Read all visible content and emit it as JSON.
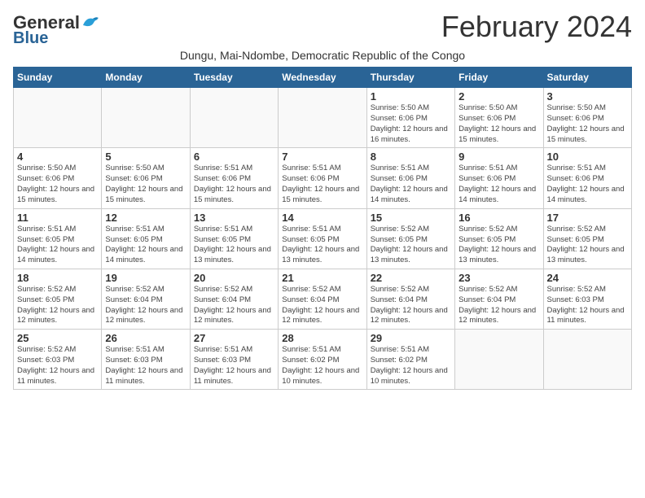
{
  "logo": {
    "general": "General",
    "blue": "Blue"
  },
  "title": "February 2024",
  "subtitle": "Dungu, Mai-Ndombe, Democratic Republic of the Congo",
  "headers": [
    "Sunday",
    "Monday",
    "Tuesday",
    "Wednesday",
    "Thursday",
    "Friday",
    "Saturday"
  ],
  "weeks": [
    [
      {
        "num": "",
        "info": ""
      },
      {
        "num": "",
        "info": ""
      },
      {
        "num": "",
        "info": ""
      },
      {
        "num": "",
        "info": ""
      },
      {
        "num": "1",
        "info": "Sunrise: 5:50 AM\nSunset: 6:06 PM\nDaylight: 12 hours\nand 16 minutes."
      },
      {
        "num": "2",
        "info": "Sunrise: 5:50 AM\nSunset: 6:06 PM\nDaylight: 12 hours\nand 15 minutes."
      },
      {
        "num": "3",
        "info": "Sunrise: 5:50 AM\nSunset: 6:06 PM\nDaylight: 12 hours\nand 15 minutes."
      }
    ],
    [
      {
        "num": "4",
        "info": "Sunrise: 5:50 AM\nSunset: 6:06 PM\nDaylight: 12 hours\nand 15 minutes."
      },
      {
        "num": "5",
        "info": "Sunrise: 5:50 AM\nSunset: 6:06 PM\nDaylight: 12 hours\nand 15 minutes."
      },
      {
        "num": "6",
        "info": "Sunrise: 5:51 AM\nSunset: 6:06 PM\nDaylight: 12 hours\nand 15 minutes."
      },
      {
        "num": "7",
        "info": "Sunrise: 5:51 AM\nSunset: 6:06 PM\nDaylight: 12 hours\nand 15 minutes."
      },
      {
        "num": "8",
        "info": "Sunrise: 5:51 AM\nSunset: 6:06 PM\nDaylight: 12 hours\nand 14 minutes."
      },
      {
        "num": "9",
        "info": "Sunrise: 5:51 AM\nSunset: 6:06 PM\nDaylight: 12 hours\nand 14 minutes."
      },
      {
        "num": "10",
        "info": "Sunrise: 5:51 AM\nSunset: 6:06 PM\nDaylight: 12 hours\nand 14 minutes."
      }
    ],
    [
      {
        "num": "11",
        "info": "Sunrise: 5:51 AM\nSunset: 6:05 PM\nDaylight: 12 hours\nand 14 minutes."
      },
      {
        "num": "12",
        "info": "Sunrise: 5:51 AM\nSunset: 6:05 PM\nDaylight: 12 hours\nand 14 minutes."
      },
      {
        "num": "13",
        "info": "Sunrise: 5:51 AM\nSunset: 6:05 PM\nDaylight: 12 hours\nand 13 minutes."
      },
      {
        "num": "14",
        "info": "Sunrise: 5:51 AM\nSunset: 6:05 PM\nDaylight: 12 hours\nand 13 minutes."
      },
      {
        "num": "15",
        "info": "Sunrise: 5:52 AM\nSunset: 6:05 PM\nDaylight: 12 hours\nand 13 minutes."
      },
      {
        "num": "16",
        "info": "Sunrise: 5:52 AM\nSunset: 6:05 PM\nDaylight: 12 hours\nand 13 minutes."
      },
      {
        "num": "17",
        "info": "Sunrise: 5:52 AM\nSunset: 6:05 PM\nDaylight: 12 hours\nand 13 minutes."
      }
    ],
    [
      {
        "num": "18",
        "info": "Sunrise: 5:52 AM\nSunset: 6:05 PM\nDaylight: 12 hours\nand 12 minutes."
      },
      {
        "num": "19",
        "info": "Sunrise: 5:52 AM\nSunset: 6:04 PM\nDaylight: 12 hours\nand 12 minutes."
      },
      {
        "num": "20",
        "info": "Sunrise: 5:52 AM\nSunset: 6:04 PM\nDaylight: 12 hours\nand 12 minutes."
      },
      {
        "num": "21",
        "info": "Sunrise: 5:52 AM\nSunset: 6:04 PM\nDaylight: 12 hours\nand 12 minutes."
      },
      {
        "num": "22",
        "info": "Sunrise: 5:52 AM\nSunset: 6:04 PM\nDaylight: 12 hours\nand 12 minutes."
      },
      {
        "num": "23",
        "info": "Sunrise: 5:52 AM\nSunset: 6:04 PM\nDaylight: 12 hours\nand 12 minutes."
      },
      {
        "num": "24",
        "info": "Sunrise: 5:52 AM\nSunset: 6:03 PM\nDaylight: 12 hours\nand 11 minutes."
      }
    ],
    [
      {
        "num": "25",
        "info": "Sunrise: 5:52 AM\nSunset: 6:03 PM\nDaylight: 12 hours\nand 11 minutes."
      },
      {
        "num": "26",
        "info": "Sunrise: 5:51 AM\nSunset: 6:03 PM\nDaylight: 12 hours\nand 11 minutes."
      },
      {
        "num": "27",
        "info": "Sunrise: 5:51 AM\nSunset: 6:03 PM\nDaylight: 12 hours\nand 11 minutes."
      },
      {
        "num": "28",
        "info": "Sunrise: 5:51 AM\nSunset: 6:02 PM\nDaylight: 12 hours\nand 10 minutes."
      },
      {
        "num": "29",
        "info": "Sunrise: 5:51 AM\nSunset: 6:02 PM\nDaylight: 12 hours\nand 10 minutes."
      },
      {
        "num": "",
        "info": ""
      },
      {
        "num": "",
        "info": ""
      }
    ]
  ]
}
